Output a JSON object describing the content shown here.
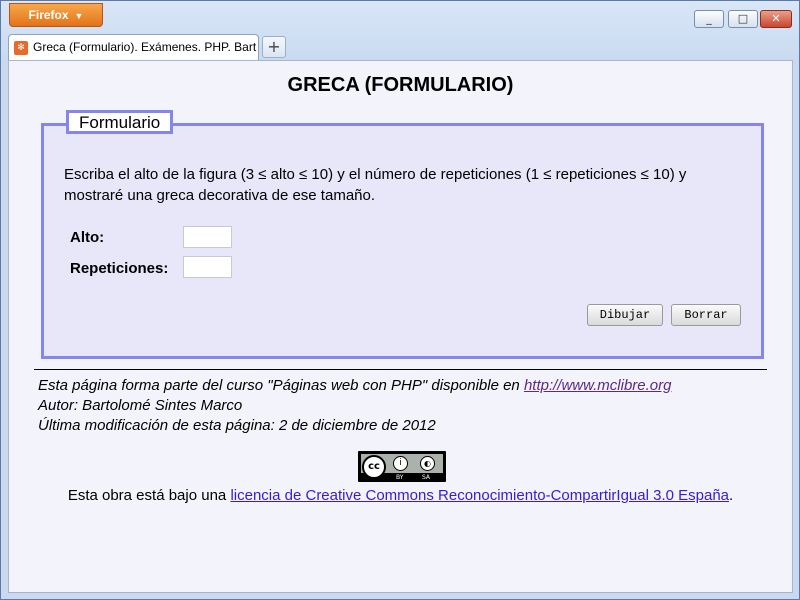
{
  "browser": {
    "menu_label": "Firefox",
    "menu_arrow": "▼",
    "tab_title": "Greca (Formulario). Exámenes. PHP. Bart…",
    "new_tab": "+",
    "window_controls": {
      "minimize": "_",
      "maximize": "□",
      "close": "✕"
    }
  },
  "page": {
    "title": "GRECA (FORMULARIO)",
    "form": {
      "legend": "Formulario",
      "intro": "Escriba el alto de la figura (3 ≤ alto ≤ 10) y el número de repeticiones (1 ≤ repeticiones ≤ 10) y mostraré una greca decorativa de ese tamaño.",
      "fields": [
        {
          "label": "Alto:",
          "value": ""
        },
        {
          "label": "Repeticiones:",
          "value": ""
        }
      ],
      "draw_button": "Dibujar",
      "reset_button": "Borrar"
    },
    "footer": {
      "line1_prefix": "Esta página forma parte del curso \"Páginas web con PHP\" disponible en ",
      "line1_link": "http://www.mclibre.org",
      "line2": "Autor: Bartolomé Sintes Marco",
      "line3": "Última modificación de esta página: 2 de diciembre de 2012"
    },
    "cc_badge": {
      "main": "cc",
      "by": "i",
      "sa": "◐",
      "by_label": "BY",
      "sa_label": "SA"
    },
    "license": {
      "prefix": "Esta obra está bajo una ",
      "link": "licencia de Creative Commons Reconocimiento-CompartirIgual 3.0 España",
      "suffix": "."
    }
  }
}
